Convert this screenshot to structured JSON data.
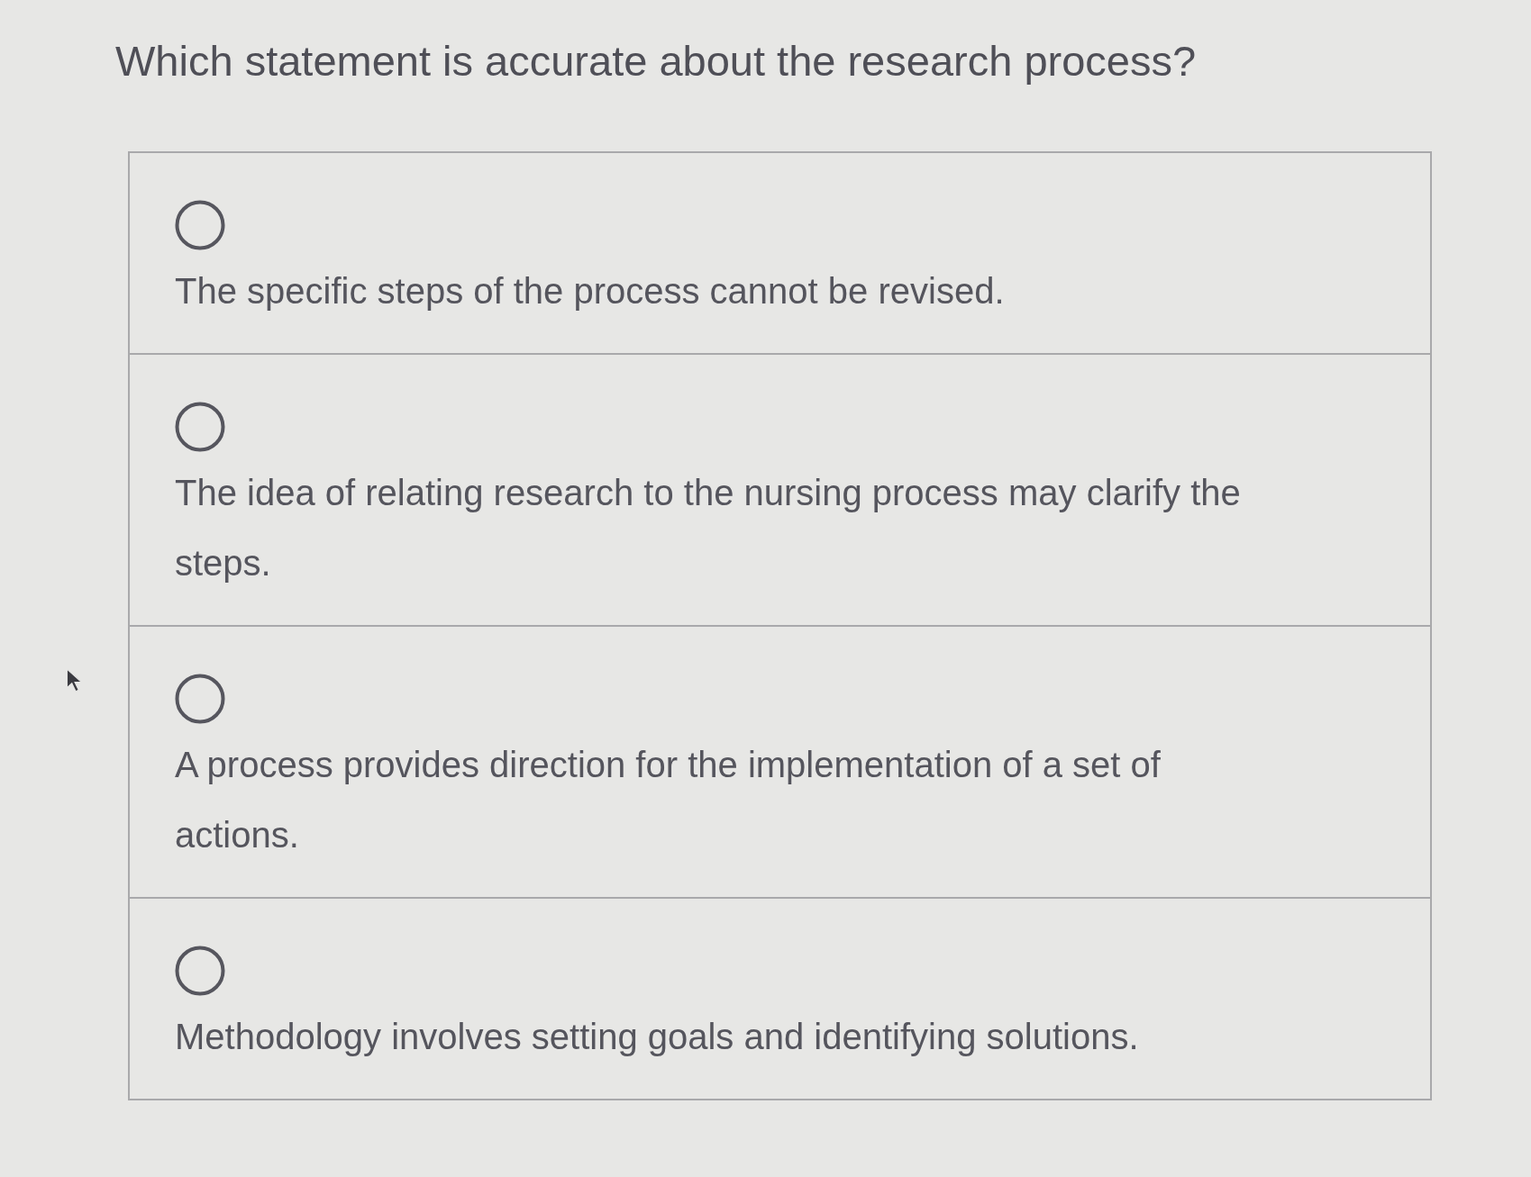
{
  "question": "Which statement is accurate about the research process?",
  "options": [
    {
      "text": "The specific steps of the process cannot be revised.",
      "selected": false
    },
    {
      "text": "The idea of relating research to the nursing process may clarify the steps.",
      "selected": false
    },
    {
      "text": "A process provides direction for the implementation of a set of actions.",
      "selected": false
    },
    {
      "text": "Methodology involves setting goals and identifying solutions.",
      "selected": false
    }
  ]
}
